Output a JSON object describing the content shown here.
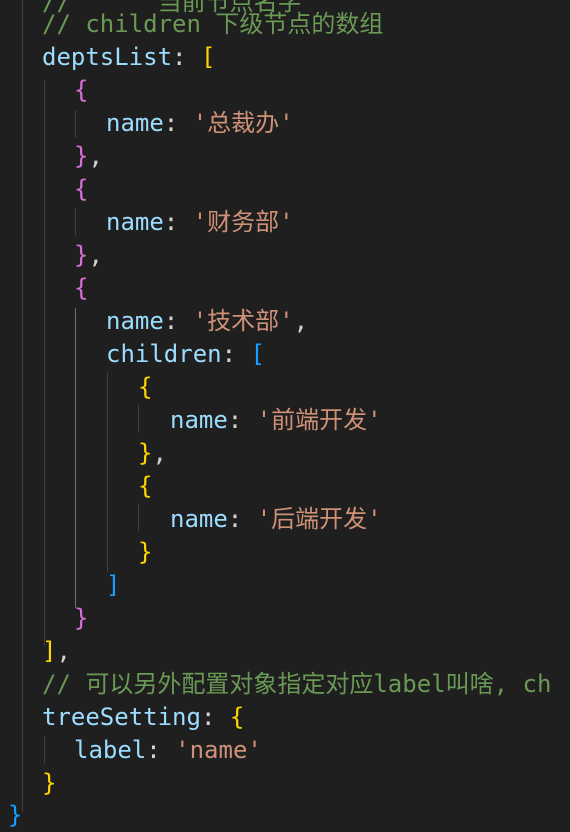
{
  "code": {
    "top_partial_comment": "//      当前节点名字",
    "comment_children": "// children 下级节点的数组",
    "depts_key": "deptsList",
    "name_key": "name",
    "children_key": "children",
    "label_key": "label",
    "tree_setting_key": "treeSetting",
    "colon": ": ",
    "open_bracket": "[",
    "close_bracket": "]",
    "open_brace": "{",
    "close_brace": "}",
    "comma": ",",
    "values": {
      "dept1": "'总裁办'",
      "dept2": "'财务部'",
      "dept3": "'技术部'",
      "child1": "'前端开发'",
      "child2": "'后端开发'",
      "label_value": "'name'"
    },
    "comment_label": "// 可以另外配置对象指定对应label叫啥, ch",
    "bottom_partial": "}"
  },
  "colors": {
    "background": "#1f1f1f",
    "comment": "#6a9955",
    "variable": "#9cdcfe",
    "string": "#ce9178",
    "bracket_level1": "#ffd700",
    "bracket_level2": "#da70d6",
    "bracket_level3": "#179fff"
  }
}
